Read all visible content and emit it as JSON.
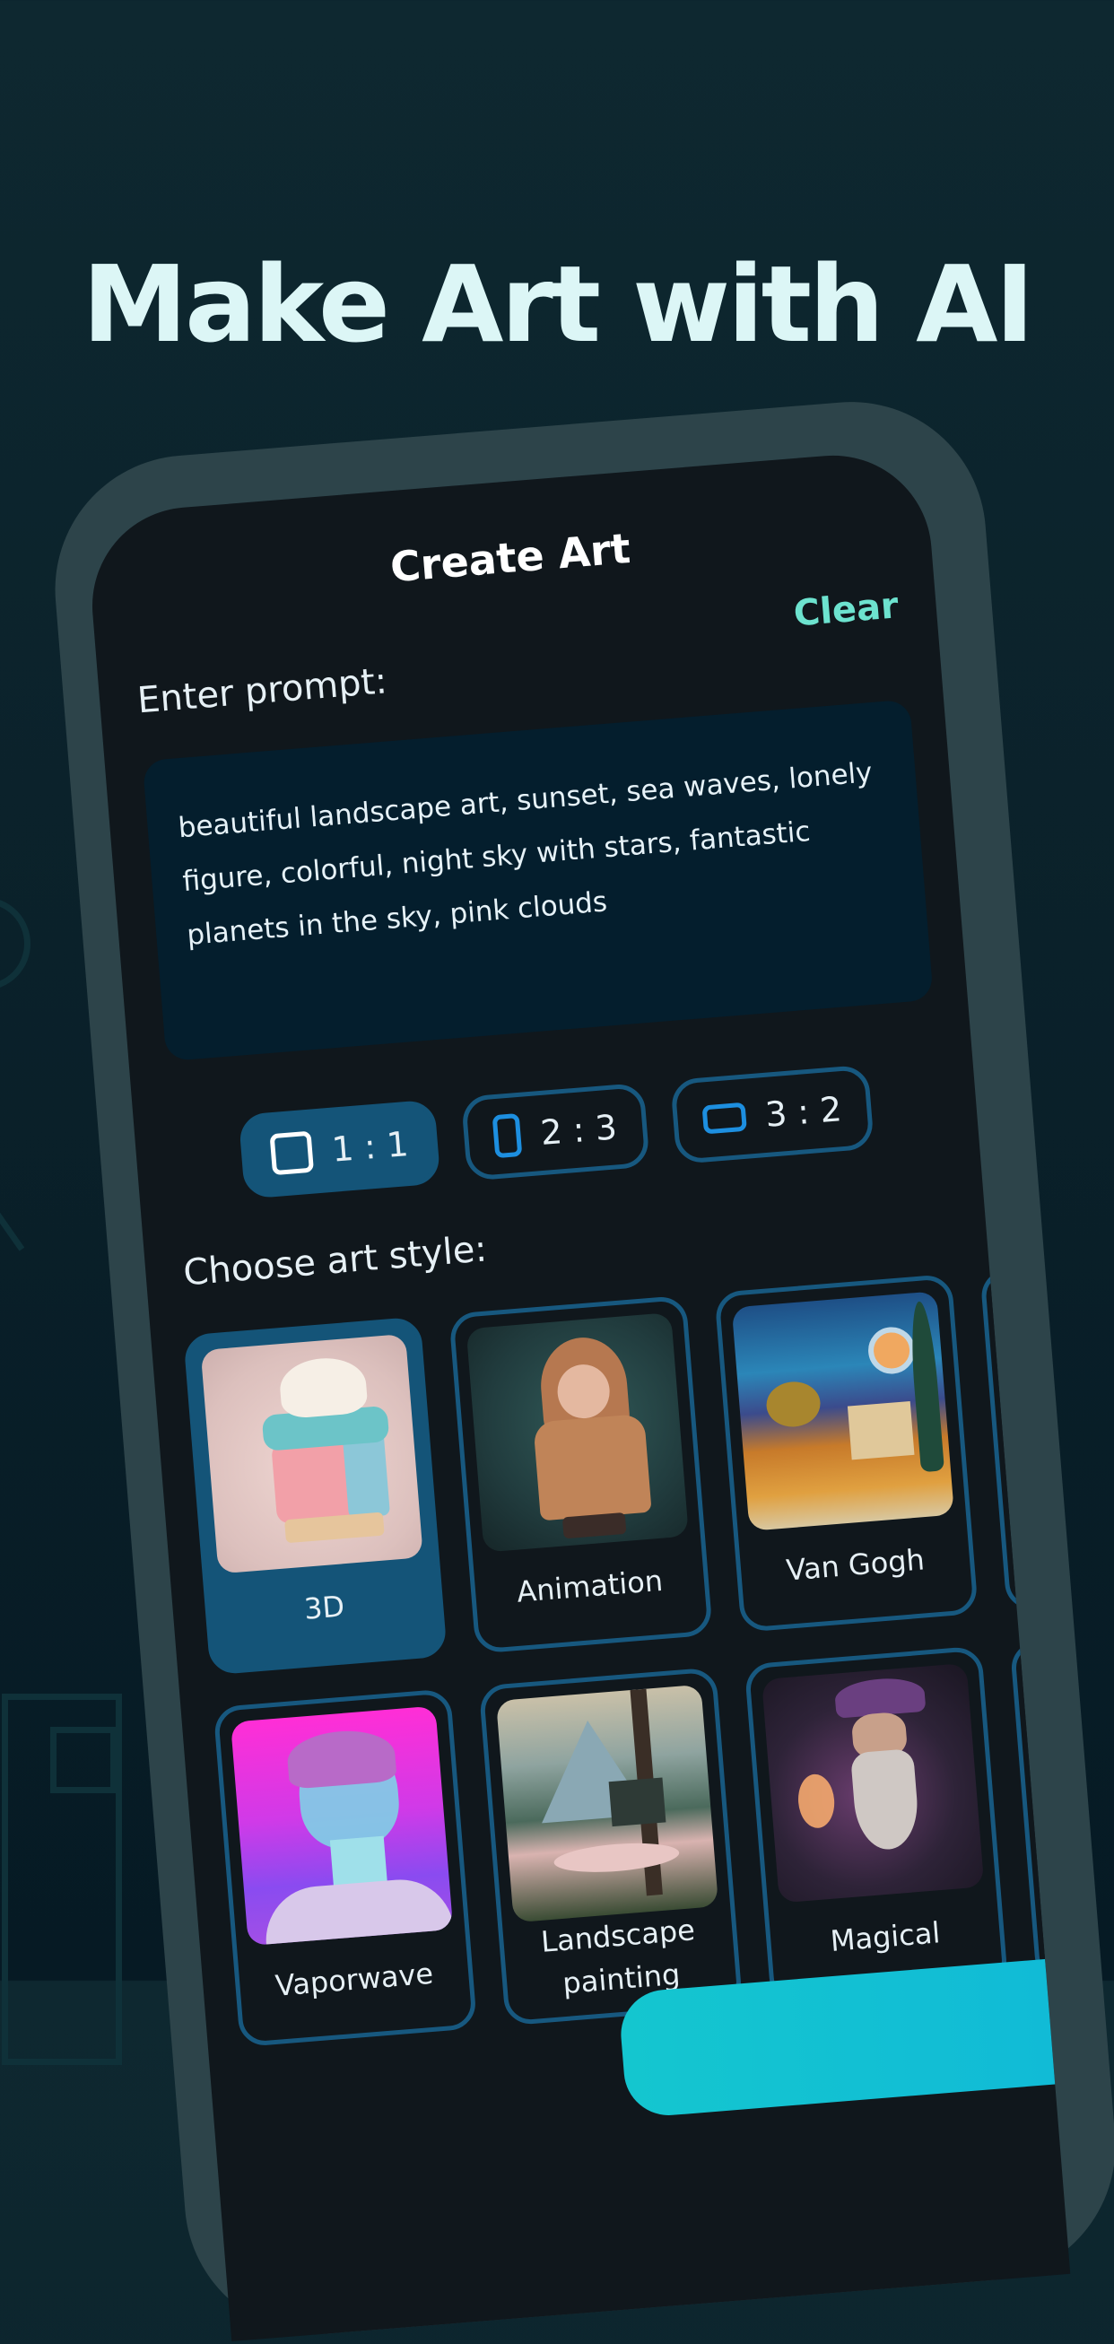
{
  "headline": "Make Art with AI",
  "screen": {
    "title": "Create Art",
    "clear_label": "Clear",
    "prompt_label": "Enter prompt:",
    "prompt_value": "beautiful landscape art, sunset, sea waves, lonely figure, colorful, night sky with stars, fantastic planets in the sky, pink clouds",
    "aspect_ratios": [
      {
        "label": "1 : 1",
        "icon": "square-icon",
        "selected": true
      },
      {
        "label": "2 : 3",
        "icon": "portrait-rect-icon",
        "selected": false
      },
      {
        "label": "3 : 2",
        "icon": "landscape-rect-icon",
        "selected": false
      }
    ],
    "style_label": "Choose art style:",
    "styles": [
      {
        "label": "3D",
        "selected": true
      },
      {
        "label": "Animation",
        "selected": false
      },
      {
        "label": "Van Gogh",
        "selected": false
      },
      {
        "label": "",
        "selected": false
      },
      {
        "label": "Vaporwave",
        "selected": false
      },
      {
        "label": "Landscape painting",
        "selected": false
      },
      {
        "label": "Magical",
        "selected": false
      },
      {
        "label": "",
        "selected": false
      }
    ]
  },
  "colors": {
    "accent": "#6de3cf",
    "selected": "#145478",
    "border": "#17587f",
    "icon_blue": "#1d8fe0",
    "generate_button": "#14c6cf"
  }
}
